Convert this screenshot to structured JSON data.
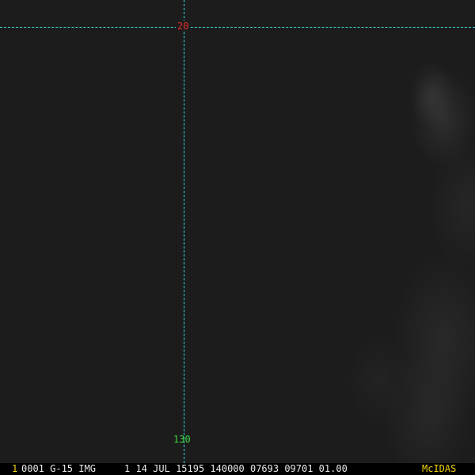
{
  "map": {
    "latitude_label": "20",
    "longitude_label": "130",
    "grid_color": "#37d6e0",
    "latitude_label_color": "#e0302a",
    "longitude_label_color": "#3cd43c"
  },
  "status_bar": {
    "frame_number": "1",
    "text": "0001 G-15 IMG     1 14 JUL 15195 140000 07693 09701 01.00",
    "brand": "McIDAS",
    "accent_color": "#f0d000"
  }
}
